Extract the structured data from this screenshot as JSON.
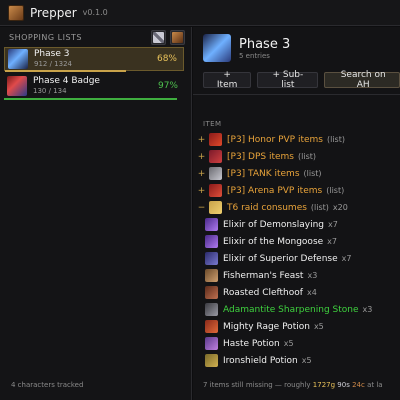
{
  "app": {
    "title": "Prepper",
    "version": "v0.1.0"
  },
  "sidebar": {
    "header": "SHOPPING LISTS",
    "lists": [
      {
        "name": "Phase 3",
        "count": "912 / 1324",
        "percent": "68%",
        "progress": 0.68,
        "selected": true,
        "pct_color": "#e8c15a",
        "bar_color": "#c9a34a"
      },
      {
        "name": "Phase 4 Badge",
        "count": "130 / 134",
        "percent": "97%",
        "progress": 0.97,
        "selected": false,
        "pct_color": "#4ec04e",
        "bar_color": "#3fae3f"
      }
    ],
    "footer": "4 characters tracked"
  },
  "main": {
    "title": "Phase 3",
    "subtitle": "5 entries",
    "toolbar": {
      "add_item": "+ Item",
      "add_sublist": "+ Sub-list",
      "search_ah": "Search on AH"
    },
    "column_header": "ITEM",
    "sublists": [
      {
        "expander": "+",
        "name": "[P3] Honor PVP items",
        "tag": "(list)"
      },
      {
        "expander": "+",
        "name": "[P3] DPS items",
        "tag": "(list)"
      },
      {
        "expander": "+",
        "name": "[P3] TANK items",
        "tag": "(list)"
      },
      {
        "expander": "+",
        "name": "[P3] Arena PVP items",
        "tag": "(list)"
      },
      {
        "expander": "−",
        "name": "T6 raid consumes",
        "tag": "(list)",
        "qty": "x20"
      }
    ],
    "items": [
      {
        "name": "Elixir of Demonslaying",
        "qty": "x7",
        "color": "#f0f0f0"
      },
      {
        "name": "Elixir of the Mongoose",
        "qty": "x7",
        "color": "#f0f0f0"
      },
      {
        "name": "Elixir of Superior Defense",
        "qty": "x7",
        "color": "#f0f0f0"
      },
      {
        "name": "Fisherman's Feast",
        "qty": "x3",
        "color": "#f0f0f0"
      },
      {
        "name": "Roasted Clefthoof",
        "qty": "x4",
        "color": "#f0f0f0"
      },
      {
        "name": "Adamantite Sharpening Stone",
        "qty": "x3",
        "color": "#3ed13e"
      },
      {
        "name": "Mighty Rage Potion",
        "qty": "x5",
        "color": "#f0f0f0"
      },
      {
        "name": "Haste Potion",
        "qty": "x5",
        "color": "#f0f0f0"
      },
      {
        "name": "Ironshield Potion",
        "qty": "x5",
        "color": "#f0f0f0"
      }
    ],
    "status": {
      "text": "7 items still missing — roughly",
      "gold": "1727g",
      "silver": "90s",
      "copper": "24c",
      "suffix": "at la"
    }
  },
  "colors": {
    "list_name": "#e8a33a",
    "accent": "#c9a34a"
  }
}
